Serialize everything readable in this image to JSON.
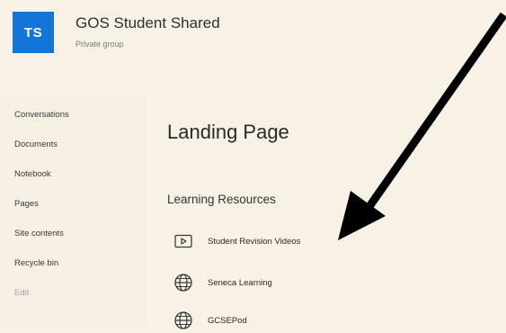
{
  "header": {
    "avatar_initials": "TS",
    "title": "GOS Student Shared",
    "subtitle": "Private group"
  },
  "sidebar": {
    "items": [
      {
        "label": "Conversations"
      },
      {
        "label": "Documents"
      },
      {
        "label": "Notebook"
      },
      {
        "label": "Pages"
      },
      {
        "label": "Site contents"
      },
      {
        "label": "Recycle bin"
      },
      {
        "label": "Edit"
      }
    ]
  },
  "main": {
    "page_title": "Landing Page",
    "section_title": "Learning Resources",
    "links": [
      {
        "label": "Student Revision Videos",
        "icon": "video-icon"
      },
      {
        "label": "Seneca Learning",
        "icon": "globe-icon"
      },
      {
        "label": "GCSEPod",
        "icon": "globe-icon"
      }
    ]
  },
  "colors": {
    "accent": "#1475d8",
    "background": "#f8f1e6",
    "arrow": "#000000"
  }
}
